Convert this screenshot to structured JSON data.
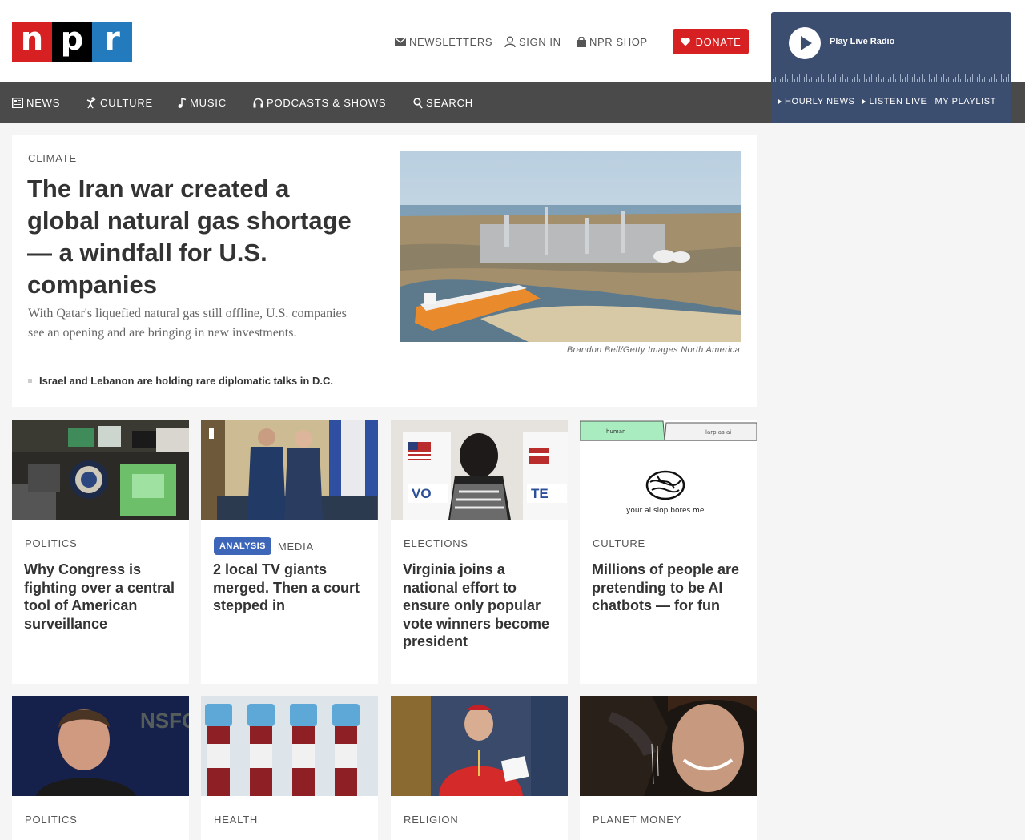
{
  "header": {
    "logo_letters": [
      "n",
      "p",
      "r"
    ],
    "utility": [
      {
        "label": "NEWSLETTERS",
        "icon": "envelope-icon"
      },
      {
        "label": "SIGN IN",
        "icon": "user-icon"
      },
      {
        "label": "NPR SHOP",
        "icon": "shopping-bag-icon"
      }
    ],
    "donate_label": "DONATE"
  },
  "player": {
    "play_label": "Play Live Radio",
    "links": [
      "HOURLY NEWS",
      "LISTEN LIVE",
      "MY PLAYLIST"
    ]
  },
  "nav": {
    "items": [
      {
        "label": "NEWS",
        "icon": "newspaper-icon"
      },
      {
        "label": "CULTURE",
        "icon": "dancer-icon"
      },
      {
        "label": "MUSIC",
        "icon": "music-note-icon"
      },
      {
        "label": "PODCASTS & SHOWS",
        "icon": "headphones-icon"
      },
      {
        "label": "SEARCH",
        "icon": "search-icon"
      }
    ]
  },
  "lead": {
    "slug": "CLIMATE",
    "title": "The Iran war created a global natural gas shortage — a windfall for U.S. companies",
    "teaser": "With Qatar's liquefied natural gas still offline, U.S. companies see an opening and are bringing in new investments.",
    "related": "Israel and Lebanon are holding rare diplomatic talks in D.C.",
    "image_credit": "Brandon Bell/Getty Images North America"
  },
  "cards_row1": [
    {
      "slug": "POLITICS",
      "badge": "",
      "title": "Why Congress is fighting over a central tool of American surveillance"
    },
    {
      "slug": "MEDIA",
      "badge": "ANALYSIS",
      "title": "2 local TV giants merged. Then a court stepped in"
    },
    {
      "slug": "ELECTIONS",
      "badge": "",
      "title": "Virginia joins a national effort to ensure only popular vote winners become president"
    },
    {
      "slug": "CULTURE",
      "badge": "",
      "title": "Millions of people are pretending to be AI chatbots — for fun"
    }
  ],
  "cards_row2": [
    {
      "slug": "POLITICS"
    },
    {
      "slug": "HEALTH"
    },
    {
      "slug": "RELIGION"
    },
    {
      "slug": "PLANET MONEY"
    }
  ],
  "image_text": {
    "tab_left": "human",
    "tab_right": "larp as ai",
    "caption": "your ai slop bores me",
    "vote_left": "VO",
    "vote_right": "TE",
    "banner_partial": "NSFO"
  },
  "colors": {
    "npr_red": "#d62021",
    "npr_blue": "#237bbd",
    "nav_bg": "#4a4a4a",
    "player_bg": "#3b4e6f",
    "badge_blue": "#3d66b8"
  }
}
